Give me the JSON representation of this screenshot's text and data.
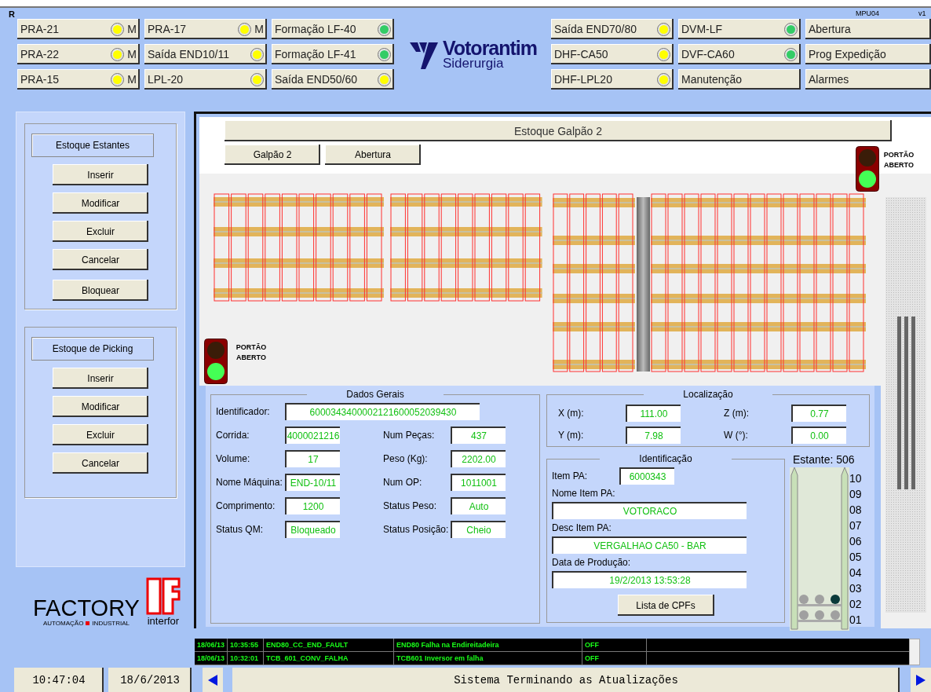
{
  "corner_mark": "R",
  "station": "MPU04",
  "version": "v1",
  "header_left": [
    {
      "buttons": [
        {
          "label": "PRA-21",
          "color": "#ffff00",
          "mode": "M"
        },
        {
          "label": "PRA-22",
          "color": "#ffff00",
          "mode": "M"
        },
        {
          "label": "PRA-15",
          "color": "#ffff00",
          "mode": "M"
        }
      ]
    },
    {
      "buttons": [
        {
          "label": "PRA-17",
          "color": "#ffff00",
          "mode": "M"
        },
        {
          "label": "Saída END10/11",
          "color": "#ffff00"
        },
        {
          "label": "LPL-20",
          "color": "#ffff00"
        }
      ]
    },
    {
      "buttons": [
        {
          "label": "Formação LF-40",
          "color": "#33cc66"
        },
        {
          "label": "Formação LF-41",
          "color": "#33cc66"
        },
        {
          "label": "Saída END50/60",
          "color": "#ffff00"
        }
      ]
    }
  ],
  "logo": {
    "name": "Votorantim",
    "subtitle": "Siderurgia"
  },
  "header_right": [
    {
      "buttons": [
        {
          "label": "Saída END70/80",
          "color": "#ffff00"
        },
        {
          "label": "DHF-CA50",
          "color": "#ffff00"
        },
        {
          "label": "DHF-LPL20",
          "color": "#ffff00"
        }
      ]
    },
    {
      "buttons": [
        {
          "label": "DVM-LF",
          "color": "#33cc66"
        },
        {
          "label": "DVF-CA60",
          "color": "#33cc66"
        },
        {
          "label": "Manutenção"
        }
      ]
    },
    {
      "buttons": [
        {
          "label": "Abertura"
        },
        {
          "label": "Prog Expedição"
        },
        {
          "label": "Alarmes"
        }
      ]
    }
  ],
  "side_panels": [
    {
      "title": "Estoque Estantes",
      "buttons": [
        "Inserir",
        "Modificar",
        "Excluir",
        "Cancelar",
        "Bloquear"
      ]
    },
    {
      "title": "Estoque de Picking",
      "buttons": [
        "Inserir",
        "Modificar",
        "Excluir",
        "Cancelar"
      ]
    }
  ],
  "brand": {
    "name": "FACTORY",
    "tagline_left": "AUTOMAÇÃO",
    "tagline_right": "INDUSTRIAL",
    "partner": "interfor"
  },
  "title": "Estoque Galpão 2",
  "tabs": [
    "Galpão 2",
    "Abertura"
  ],
  "gates": [
    {
      "label": "PORTÃO ABERTO",
      "open": true
    },
    {
      "label": "PORTÃO ABERTO",
      "open": true
    }
  ],
  "dados_gerais": {
    "title": "Dados Gerais",
    "identifier": {
      "label": "Identificador:",
      "value": "6000343400002121600052039430"
    },
    "left": [
      {
        "label": "Corrida:",
        "value": "4000021216"
      },
      {
        "label": "Volume:",
        "value": "17"
      },
      {
        "label": "Nome Máquina:",
        "value": "END-10/11"
      },
      {
        "label": "Comprimento:",
        "value": "1200"
      },
      {
        "label": "Status QM:",
        "value": "Bloqueado"
      }
    ],
    "right": [
      {
        "label": "Num Peças:",
        "value": "437"
      },
      {
        "label": "Peso (Kg):",
        "value": "2202.00"
      },
      {
        "label": "Num OP:",
        "value": "1011001"
      },
      {
        "label": "Status Peso:",
        "value": "Auto"
      },
      {
        "label": "Status Posição:",
        "value": "Cheio"
      }
    ]
  },
  "localizacao": {
    "title": "Localização",
    "fields": [
      {
        "label": "X (m):",
        "value": "111.00"
      },
      {
        "label": "Z (m):",
        "value": "0.77"
      },
      {
        "label": "Y (m):",
        "value": "7.98"
      },
      {
        "label": "W (°):",
        "value": "0.00"
      }
    ]
  },
  "identificacao": {
    "title": "Identificação",
    "item": {
      "label": "Item PA:",
      "value": "6000343"
    },
    "fields": [
      {
        "label": "Nome Item PA:",
        "value": "VOTORACO"
      },
      {
        "label": "Desc Item PA:",
        "value": "VERGALHAO CA50 - BAR"
      },
      {
        "label": "Data de Produção:",
        "value": "19/2/2013 13:53:28"
      }
    ],
    "button": "Lista de CPFs"
  },
  "shelf": {
    "title": "Estante: 506",
    "levels": [
      {
        "label": "10"
      },
      {
        "label": "09"
      },
      {
        "label": "08"
      },
      {
        "label": "07"
      },
      {
        "label": "06"
      },
      {
        "label": "05"
      },
      {
        "label": "04"
      },
      {
        "label": "03"
      },
      {
        "label": "02",
        "slots": [
          {
            "selected": false
          },
          {
            "selected": false
          },
          {
            "selected": true
          }
        ]
      },
      {
        "label": "01",
        "slots": [
          {
            "selected": false
          },
          {
            "selected": false
          },
          {
            "selected": false
          }
        ]
      }
    ]
  },
  "alarms": [
    {
      "date": "18/06/13",
      "time": "10:35:55",
      "tag": "END80_CC_END_FAULT",
      "message": "END80 Falha na Endireitadeira",
      "state": "OFF"
    },
    {
      "date": "18/06/13",
      "time": "10:32:01",
      "tag": "TCB_601_CONV_FALHA",
      "message": "TCB601 Inversor em falha",
      "state": "OFF"
    }
  ],
  "status_bar": {
    "time": "10:47:04",
    "date": "18/6/2013",
    "message": "Sistema Terminando as Atualizações"
  }
}
